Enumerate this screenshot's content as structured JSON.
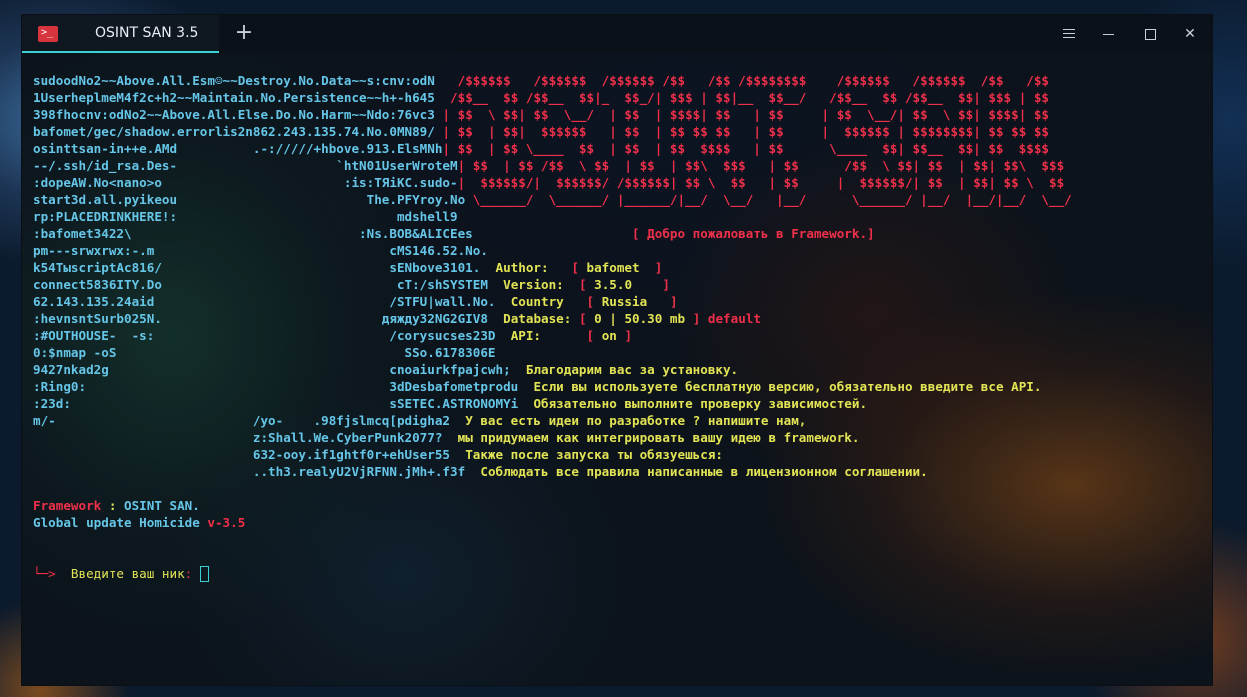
{
  "window": {
    "tab_title": "OSINT SAN 3.5",
    "tab_icon": "terminal-icon",
    "new_tab": "+",
    "controls": [
      "menu-icon",
      "minimize-icon",
      "maximize-icon",
      "close-icon"
    ]
  },
  "colors": {
    "cyan": "#66c6e8",
    "red": "#f0304a",
    "yellow": "#e2e455",
    "accent": "#3ad1d6"
  },
  "left_art": [
    "sudoodNo2~~Above.All.Esm☺~~Destroy.No.Data~~s:cnv:odN",
    "1UserheplmeM4f2c+h2~~Maintain.No.Persistence~~h+-h645",
    "398fhocnv:odNo2~~Above.All.Else.Do.No.Harm~~Ndo:76vc3",
    "bafomet/gec/shadow.errorlis2n862.243.135.74.No.0MN89/",
    "osinttsan-in++e.AMd          .-://///+hbove.913.ElsMNh",
    "--/.ssh/id_rsa.Des-                     `htN01UserWroteM",
    ":dopeAW.No<nano>o                        :is:TЯiKC.sudo-",
    "start3d.all.pyikeou                         The.PFYroy.No",
    "rp:PLACEDRINKHERE!:                             mdshell9",
    ":bafomet3422\\                              :Ns.BOB&ALICEes",
    "pm---srwxrwx:-.m                               cMS146.52.No.",
    "k54TыscriptAc816/                              sENbove3101.",
    "connect5836ITY.Do                               cT:/shSYSTEM",
    "62.143.135.24aid                               /STFU|wall.No.",
    ":hevnsntSurb025N.                             дяжду32NG2GIV8",
    ":#OUTHOUSE-  -s:                               /corysucses23D",
    "0:$nmap -oS                                      SSo.6178306E",
    "9427nkad2g                                     cnoaiurkfpajcwh;",
    ":Ring0:                                        3dDesbafometprodu",
    ":23d:                                          sSETEC.ASTRONOMYi",
    "m/-                          /yo-    .98fjslmcq[pdigha2",
    "                             z:Shall.We.CyberPunk2077?",
    "                             632-ooy.if1ghtf0r+ehUser55",
    "                             ..th3.realyU2VjRFNN.jMh+.f3f"
  ],
  "banner": [
    "  /$$$$$$   /$$$$$$  /$$$$$$ /$$   /$$ /$$$$$$$$    /$$$$$$   /$$$$$$  /$$   /$$",
    " /$$__  $$ /$$__  $$|_  $$_/| $$$ | $$|__  $$__/   /$$__  $$ /$$__  $$| $$$ | $$",
    "| $$  \\ $$| $$  \\__/  | $$  | $$$$| $$   | $$     | $$  \\__/| $$  \\ $$| $$$$| $$",
    "| $$  | $$|  $$$$$$   | $$  | $$ $$ $$   | $$     |  $$$$$$ | $$$$$$$$| $$ $$ $$",
    "| $$  | $$ \\____  $$  | $$  | $$  $$$$   | $$      \\____  $$| $$__  $$| $$  $$$$",
    "| $$  | $$ /$$  \\ $$  | $$  | $$\\  $$$   | $$      /$$  \\ $$| $$  | $$| $$\\  $$$",
    "|  $$$$$$/|  $$$$$$/ /$$$$$$| $$ \\  $$   | $$     |  $$$$$$/| $$  | $$| $$ \\  $$",
    " \\______/  \\______/ |______/|__/  \\__/   |__/      \\______/ |__/  |__/|__/  \\__/"
  ],
  "welcome": "[ Добро пожаловать в Framework.]",
  "info": [
    {
      "label": "Author:   ",
      "lb": "[ ",
      "value": "bafomet ",
      "rb": " ]",
      "extra": ""
    },
    {
      "label": "Version:  ",
      "lb": "[ ",
      "value": "3.5.0   ",
      "rb": " ]",
      "extra": ""
    },
    {
      "label": "Country   ",
      "lb": "[ ",
      "value": "Russia  ",
      "rb": " ]",
      "extra": ""
    },
    {
      "label": "Database: ",
      "lb": "[ ",
      "value": "0 | 50.30 mb",
      "rb": " ]",
      "extra": " default"
    },
    {
      "label": "API:      ",
      "lb": "[ ",
      "value": "on",
      "rb": " ]",
      "extra": ""
    }
  ],
  "messages": [
    "Благодарим вас за установку.",
    "Если вы используете бесплатную версию, обязательно введите все API.",
    "Обязательно выполните проверку зависимостей.",
    "У вас есть идеи по разработке ? напишите нам,",
    "мы придумаем как интегрировать вашу идею в framework.",
    "Также после запуска ты обязуешься:",
    "Соблюдать все правила написанные в лицензионном соглашении."
  ],
  "framework": {
    "label": "Framework",
    "sep": " : ",
    "value": "OSINT SAN."
  },
  "update": {
    "label": "Global update Homicide",
    "version": " v-3.5"
  },
  "prompt": {
    "arrow": "└─>",
    "text": "  Введите ваш ник",
    "colon": ": "
  }
}
